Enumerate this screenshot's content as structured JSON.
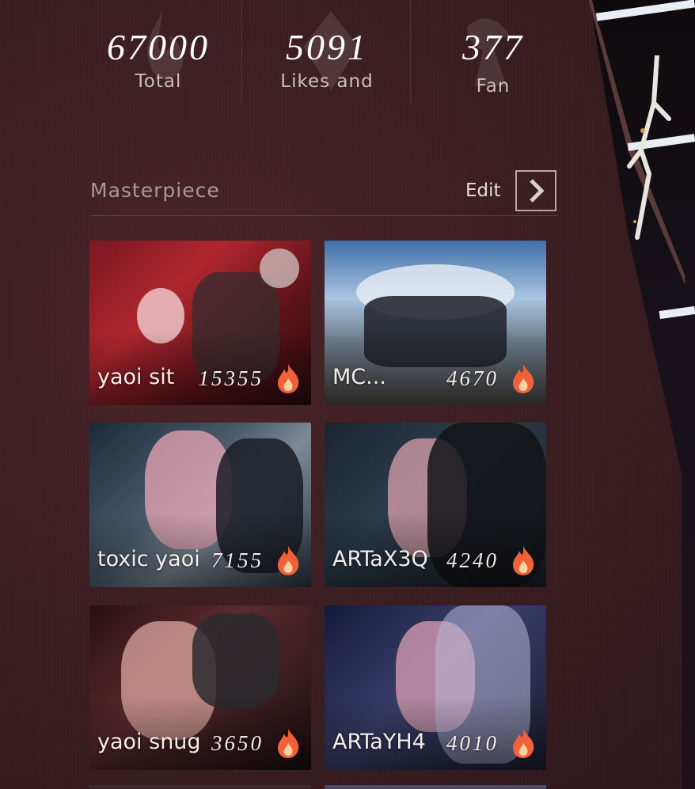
{
  "stats": [
    {
      "value": "67000",
      "label": "Total"
    },
    {
      "value": "5091",
      "label": "Likes and"
    },
    {
      "value": "377",
      "label": "Fan"
    }
  ],
  "section": {
    "title": "Masterpiece",
    "edit_label": "Edit"
  },
  "works": [
    {
      "name": "yaoi sit",
      "count": "15355"
    },
    {
      "name": "MC...",
      "count": "4670"
    },
    {
      "name": "toxic yaoi",
      "count": "7155"
    },
    {
      "name": "ARTaX3Q",
      "count": "4240"
    },
    {
      "name": "yaoi snug",
      "count": "3650"
    },
    {
      "name": "ARTaYH4",
      "count": "4010"
    }
  ],
  "icons": {
    "edit": "chevron-right-icon",
    "heat": "flame-icon",
    "watermark": "emblem-icon"
  },
  "colors": {
    "background": "#3c1e22",
    "flame": "#f0613a",
    "text": "#ffffff"
  }
}
